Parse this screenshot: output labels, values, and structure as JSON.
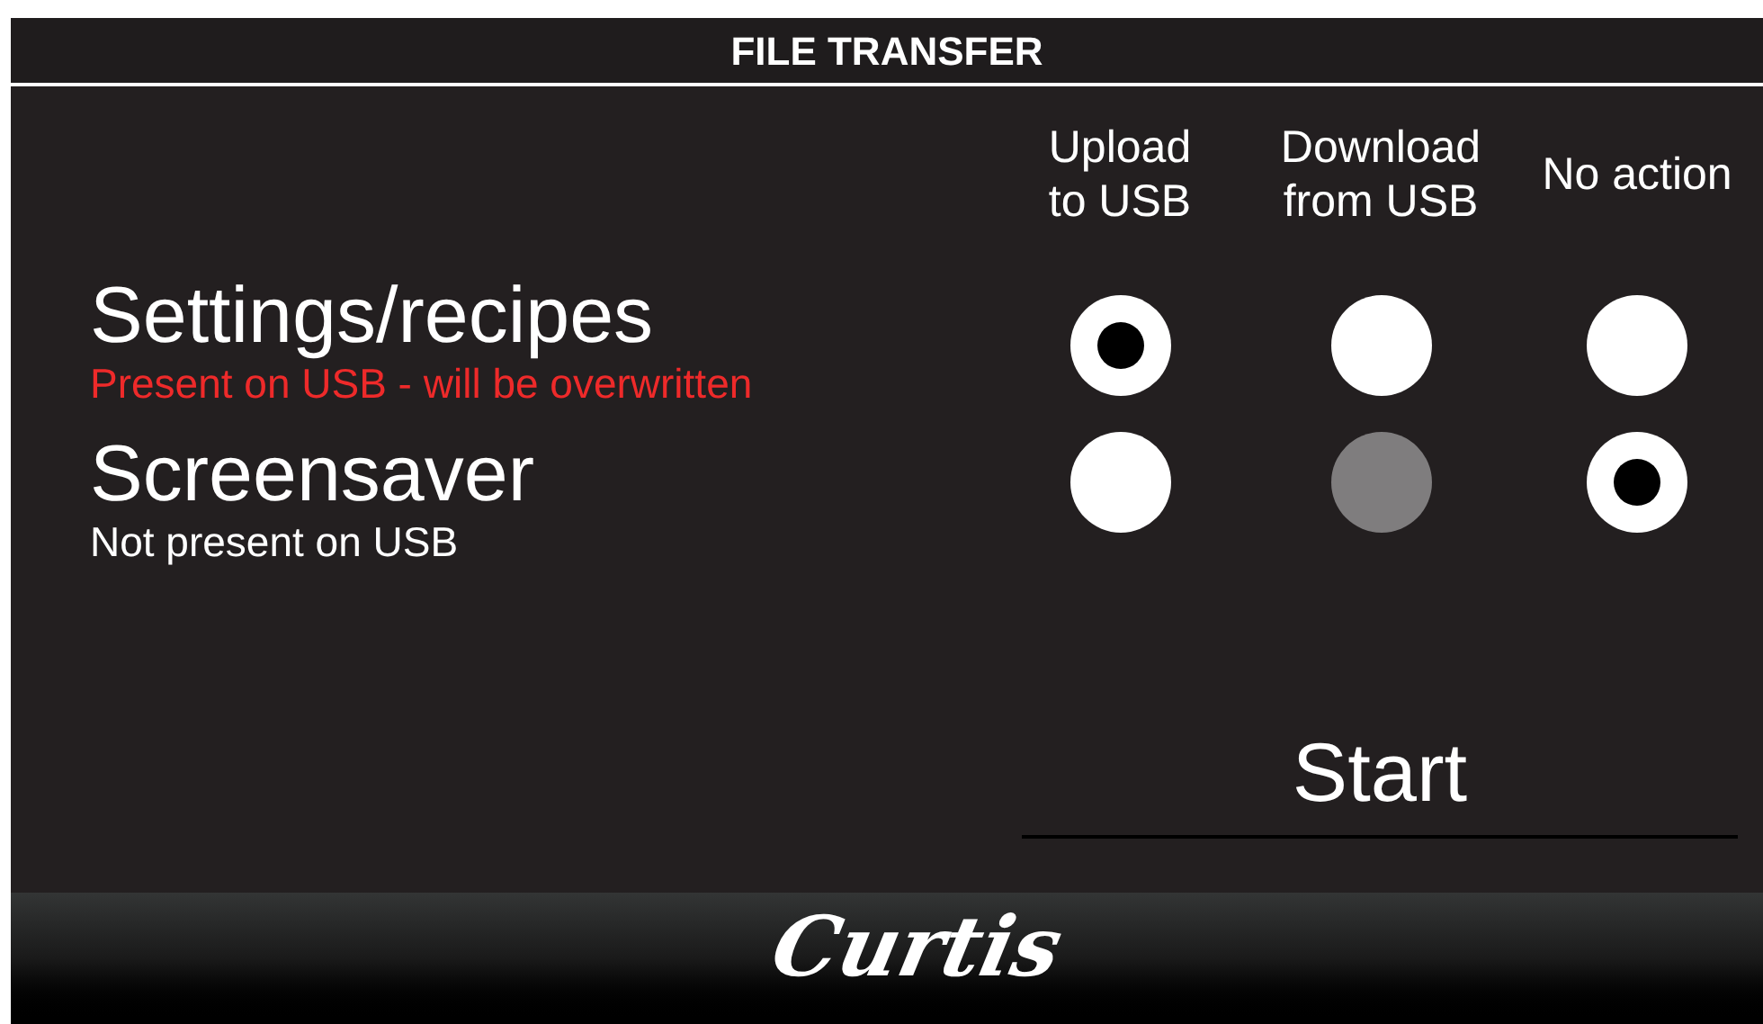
{
  "title": "FILE TRANSFER",
  "columns": [
    {
      "lines": [
        "Upload",
        "to USB"
      ]
    },
    {
      "lines": [
        "Download",
        "from USB"
      ]
    },
    {
      "lines": [
        "No action"
      ]
    }
  ],
  "rows": [
    {
      "name": "Settings/recipes",
      "status": "Present on USB - will be overwritten",
      "warning": true,
      "options": [
        {
          "selected": true,
          "disabled": false
        },
        {
          "selected": false,
          "disabled": false
        },
        {
          "selected": false,
          "disabled": false
        }
      ]
    },
    {
      "name": "Screensaver",
      "status": "Not present on USB",
      "warning": false,
      "options": [
        {
          "selected": false,
          "disabled": false
        },
        {
          "selected": false,
          "disabled": true
        },
        {
          "selected": true,
          "disabled": false
        }
      ]
    }
  ],
  "start_button": "Start",
  "logo": "Curtis"
}
